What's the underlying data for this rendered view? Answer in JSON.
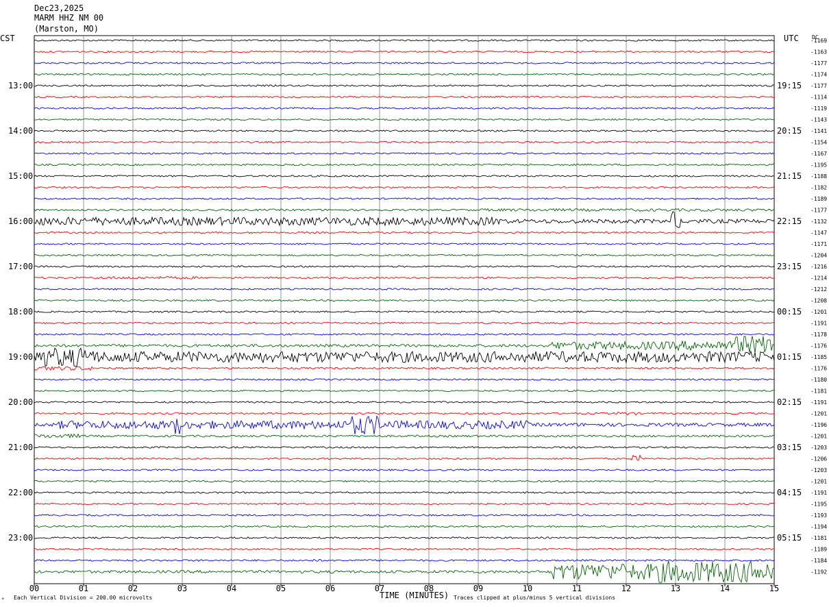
{
  "header": {
    "date": "Dec23,2025",
    "station": "MARM HHZ NM 00",
    "location": "(Marston, MO)"
  },
  "left_axis_title": "CST",
  "right_axis_title": "UTC",
  "dc_title": "DC",
  "footer": {
    "scale_note": "Each Vertical Division =  200.00 microvolts",
    "time_axis_label": "TIME (MINUTES)",
    "clip_note": "Traces clipped at plus/minus 5 vertical divisions",
    "corner_mark": "*"
  },
  "colors": {
    "trace_cycle": [
      "#000000",
      "#ff0000",
      "#0000ff",
      "#006400"
    ],
    "grid": "#7a7a7a",
    "frame": "#000000"
  },
  "chart_data": {
    "type": "line",
    "subtype": "helicorder",
    "x_ticks": [
      "00",
      "01",
      "02",
      "03",
      "04",
      "05",
      "06",
      "07",
      "08",
      "09",
      "10",
      "11",
      "12",
      "13",
      "14",
      "15"
    ],
    "xlim": [
      0,
      15
    ],
    "line_minutes": 15,
    "left_time_labels": [
      {
        "line": 4,
        "text": "13:00"
      },
      {
        "line": 8,
        "text": "14:00"
      },
      {
        "line": 12,
        "text": "15:00"
      },
      {
        "line": 16,
        "text": "16:00"
      },
      {
        "line": 20,
        "text": "17:00"
      },
      {
        "line": 24,
        "text": "18:00"
      },
      {
        "line": 28,
        "text": "19:00"
      },
      {
        "line": 32,
        "text": "20:00"
      },
      {
        "line": 36,
        "text": "21:00"
      },
      {
        "line": 40,
        "text": "22:00"
      },
      {
        "line": 44,
        "text": "23:00"
      }
    ],
    "right_time_labels": [
      {
        "line": 4,
        "text": "19:15"
      },
      {
        "line": 8,
        "text": "20:15"
      },
      {
        "line": 12,
        "text": "21:15"
      },
      {
        "line": 16,
        "text": "22:15"
      },
      {
        "line": 20,
        "text": "23:15"
      },
      {
        "line": 24,
        "text": "00:15"
      },
      {
        "line": 28,
        "text": "01:15"
      },
      {
        "line": 32,
        "text": "02:15"
      },
      {
        "line": 36,
        "text": "03:15"
      },
      {
        "line": 40,
        "text": "04:15"
      },
      {
        "line": 44,
        "text": "05:15"
      }
    ],
    "dc_offsets": [
      "-1169",
      "-1163",
      "-1177",
      "-1174",
      "-1177",
      "-1114",
      "-1119",
      "-1143",
      "-1141",
      "-1154",
      "-1167",
      "-1195",
      "-1188",
      "-1182",
      "-1189",
      "-1177",
      "-1132",
      "-1147",
      "-1171",
      "-1204",
      "-1216",
      "-1214",
      "-1212",
      "-1208",
      "-1201",
      "-1191",
      "-1178",
      "-1176",
      "-1185",
      "-1176",
      "-1180",
      "-1181",
      "-1191",
      "-1201",
      "-1196",
      "-1201",
      "-1203",
      "-1206",
      "-1203",
      "-1201",
      "-1191",
      "-1195",
      "-1193",
      "-1194",
      "-1181",
      "-1189",
      "-1184",
      "-1192"
    ],
    "traces": [
      {
        "noise": 1.2,
        "events": []
      },
      {
        "noise": 1.2,
        "events": []
      },
      {
        "noise": 1.2,
        "events": []
      },
      {
        "noise": 1.2,
        "events": [
          {
            "start": 5.5,
            "end": 5.7,
            "amp": 1.5
          }
        ]
      },
      {
        "noise": 1.2,
        "events": []
      },
      {
        "noise": 1.2,
        "events": []
      },
      {
        "noise": 1.2,
        "events": []
      },
      {
        "noise": 1.2,
        "events": []
      },
      {
        "noise": 1.2,
        "events": []
      },
      {
        "noise": 1.2,
        "events": []
      },
      {
        "noise": 1.2,
        "events": []
      },
      {
        "noise": 1.2,
        "events": []
      },
      {
        "noise": 1.2,
        "events": []
      },
      {
        "noise": 1.2,
        "events": []
      },
      {
        "noise": 1.2,
        "events": []
      },
      {
        "noise": 1.4,
        "events": [
          {
            "start": 9.0,
            "end": 15.0,
            "amp": 2.0
          }
        ]
      },
      {
        "noise": 3.0,
        "events": [
          {
            "start": 0.0,
            "end": 9.5,
            "amp": 6.0
          },
          {
            "start": 12.9,
            "end": 13.1,
            "amp": 14.0
          }
        ]
      },
      {
        "noise": 1.2,
        "events": []
      },
      {
        "noise": 1.2,
        "events": []
      },
      {
        "noise": 1.2,
        "events": []
      },
      {
        "noise": 1.2,
        "events": []
      },
      {
        "noise": 1.2,
        "events": [
          {
            "start": 1.2,
            "end": 3.3,
            "amp": 2.0
          }
        ]
      },
      {
        "noise": 1.2,
        "events": []
      },
      {
        "noise": 1.2,
        "events": []
      },
      {
        "noise": 1.2,
        "events": []
      },
      {
        "noise": 1.2,
        "events": []
      },
      {
        "noise": 1.2,
        "events": []
      },
      {
        "noise": 2.0,
        "events": [
          {
            "start": 10.5,
            "end": 13.0,
            "amp": 6.0
          },
          {
            "start": 13.0,
            "end": 15.0,
            "amp": 7.0
          },
          {
            "start": 14.2,
            "end": 15.0,
            "amp": 14.0
          }
        ]
      },
      {
        "noise": 4.0,
        "events": [
          {
            "start": 0.0,
            "end": 1.2,
            "amp": 14.0
          },
          {
            "start": 1.2,
            "end": 15.0,
            "amp": 8.0
          }
        ]
      },
      {
        "noise": 1.4,
        "events": [
          {
            "start": 0.0,
            "end": 1.2,
            "amp": 3.0
          }
        ]
      },
      {
        "noise": 1.2,
        "events": []
      },
      {
        "noise": 1.2,
        "events": []
      },
      {
        "noise": 1.2,
        "events": []
      },
      {
        "noise": 1.3,
        "events": [
          {
            "start": 11.8,
            "end": 12.2,
            "amp": 2.5
          }
        ]
      },
      {
        "noise": 2.5,
        "events": [
          {
            "start": 0.5,
            "end": 10.0,
            "amp": 6.0
          },
          {
            "start": 2.8,
            "end": 3.0,
            "amp": 14.0
          },
          {
            "start": 6.4,
            "end": 7.0,
            "amp": 14.0
          }
        ]
      },
      {
        "noise": 1.5,
        "events": [
          {
            "start": 0.0,
            "end": 1.0,
            "amp": 3.0
          }
        ]
      },
      {
        "noise": 1.2,
        "events": []
      },
      {
        "noise": 1.2,
        "events": [
          {
            "start": 12.1,
            "end": 12.3,
            "amp": 5.0
          }
        ]
      },
      {
        "noise": 1.2,
        "events": []
      },
      {
        "noise": 1.2,
        "events": []
      },
      {
        "noise": 1.2,
        "events": []
      },
      {
        "noise": 1.2,
        "events": []
      },
      {
        "noise": 1.2,
        "events": []
      },
      {
        "noise": 1.2,
        "events": []
      },
      {
        "noise": 1.2,
        "events": []
      },
      {
        "noise": 1.2,
        "events": []
      },
      {
        "noise": 1.3,
        "events": [
          {
            "start": 5.6,
            "end": 5.8,
            "amp": 2.0
          }
        ]
      },
      {
        "noise": 2.0,
        "events": [
          {
            "start": 10.5,
            "end": 15.0,
            "amp": 12.0
          },
          {
            "start": 12.5,
            "end": 15.0,
            "amp": 16.0
          }
        ]
      }
    ]
  }
}
